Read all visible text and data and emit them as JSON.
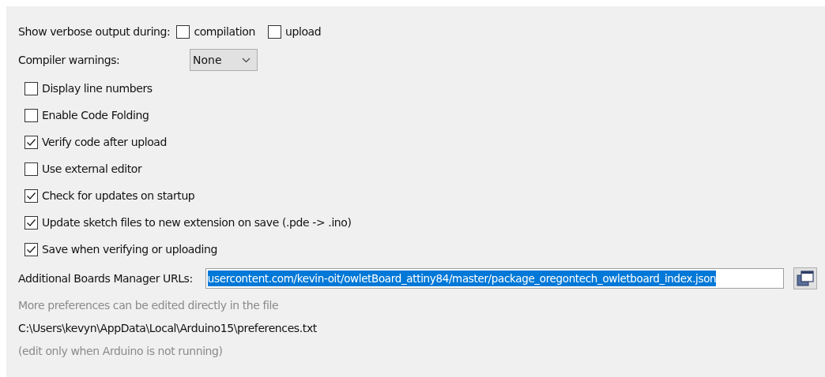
{
  "verbose": {
    "label": "Show verbose output during:",
    "options": [
      {
        "label": "compilation",
        "checked": false
      },
      {
        "label": "upload",
        "checked": false
      }
    ]
  },
  "compiler_warnings": {
    "label": "Compiler warnings:",
    "value": "None"
  },
  "options": [
    {
      "label": "Display line numbers",
      "checked": false
    },
    {
      "label": "Enable Code Folding",
      "checked": false
    },
    {
      "label": "Verify code after upload",
      "checked": true
    },
    {
      "label": "Use external editor",
      "checked": false
    },
    {
      "label": "Check for updates on startup",
      "checked": true
    },
    {
      "label": "Update sketch files to new extension on save (.pde -> .ino)",
      "checked": true
    },
    {
      "label": "Save when verifying or uploading",
      "checked": true
    }
  ],
  "boards_urls": {
    "label": "Additional Boards Manager URLs:",
    "value": "usercontent.com/kevin-oit/owletBoard_attiny84/master/package_oregontech_owletboard_index.json",
    "selected": true
  },
  "notes": [
    {
      "text": "More preferences can be edited directly in the file",
      "kind": "hint"
    },
    {
      "text": "C:\\Users\\kevyn\\AppData\\Local\\Arduino15\\preferences.txt",
      "kind": "path"
    },
    {
      "text": "(edit only when Arduino is not running)",
      "kind": "hint"
    }
  ]
}
